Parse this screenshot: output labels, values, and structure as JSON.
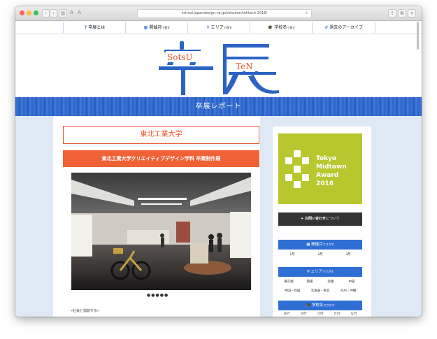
{
  "browser": {
    "url": "school.japandesign.ne.jp/sotsuten/tohtech-2016/"
  },
  "nav": [
    {
      "icon": "?",
      "label": "卒展とは",
      "small": ""
    },
    {
      "icon": "▦",
      "label": "開催月",
      "small": "で探す"
    },
    {
      "icon": "⚲",
      "label": "エリア",
      "small": "で探す"
    },
    {
      "icon": "🎓",
      "label": "学校名",
      "small": "で探す"
    },
    {
      "icon": "↺",
      "label": "過去のアーカイブ",
      "small": ""
    }
  ],
  "logo": {
    "left": "SotsU",
    "right": "TeN",
    "kanji": "卒展"
  },
  "band_title": "卒展レポート",
  "school_name": "東北工業大学",
  "exhibit_title": "東北工業大学クリエイティブデザイン学科 卒業制作展",
  "slider_dots": "●●●●●",
  "caption": "«社会と協創する»",
  "sidebar": {
    "award": [
      "Tokyo",
      "Midtown",
      "Award",
      "2016"
    ],
    "contact": {
      "strong": "お問い合わせ",
      "small": "について"
    },
    "month": {
      "title": "開催月",
      "small": "でさがす",
      "items": [
        "1月",
        "2月",
        "3月"
      ]
    },
    "area": {
      "title": "エリア",
      "small": "でさがす",
      "items": [
        "東京都",
        "関東",
        "近畿",
        "中部",
        "中国・四国",
        "北海道・東北",
        "九州・沖縄"
      ]
    },
    "school": {
      "title": "学校名",
      "small": "でさがす",
      "items": [
        "あ行",
        "か行",
        "さ行",
        "た行",
        "な行"
      ]
    }
  },
  "colors": {
    "accent_blue": "#2f6fd4",
    "accent_orange": "#f06235",
    "award_green": "#b8c72d"
  }
}
